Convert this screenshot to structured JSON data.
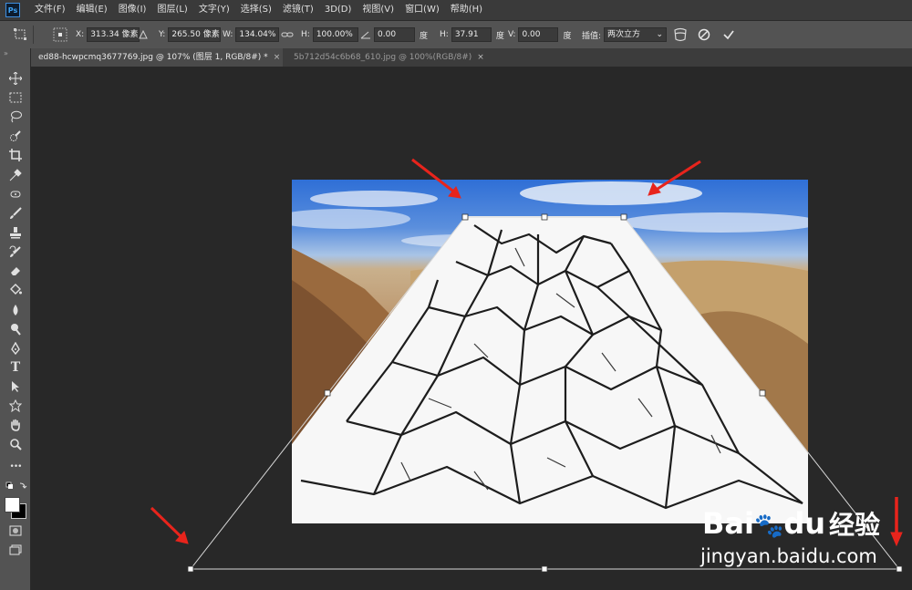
{
  "app": {
    "logo": "Ps"
  },
  "menu": [
    "文件(F)",
    "编辑(E)",
    "图像(I)",
    "图层(L)",
    "文字(Y)",
    "选择(S)",
    "滤镜(T)",
    "3D(D)",
    "视图(V)",
    "窗口(W)",
    "帮助(H)"
  ],
  "options": {
    "x_label": "X:",
    "x_value": "313.34 像素",
    "y_label": "Y:",
    "y_value": "265.50 像素",
    "w_label": "W:",
    "w_value": "134.04%",
    "h_label": "H:",
    "h_value": "100.00%",
    "angle_value": "0.00",
    "angle_unit": "度",
    "hskew_label": "H:",
    "hskew_value": "37.91",
    "hskew_unit": "度",
    "vskew_label": "V:",
    "vskew_value": "0.00",
    "vskew_unit": "度",
    "interp_label": "插值:",
    "interp_value": "两次立方"
  },
  "tabs": [
    {
      "label": "ed88-hcwpcmq3677769.jpg @ 107% (图层 1, RGB/8#) *",
      "close": "×"
    },
    {
      "label": "5b712d54c6b68_610.jpg @ 100%(RGB/8#)",
      "close": "×"
    }
  ],
  "tools": [
    "move-icon",
    "marquee-icon",
    "lasso-icon",
    "quick-select-icon",
    "crop-icon",
    "eyedropper-icon",
    "healing-icon",
    "brush-icon",
    "stamp-icon",
    "history-brush-icon",
    "eraser-icon",
    "paint-bucket-icon",
    "blur-icon",
    "dodge-icon",
    "pen-icon",
    "type-icon",
    "path-select-icon",
    "shape-icon",
    "hand-icon",
    "zoom-icon",
    "more-icon"
  ],
  "tool_glyphs": {
    "type": "T",
    "more": "•••"
  },
  "colors": {
    "accent_arrow": "#e8241c",
    "menubar": "#3a3a3a",
    "optionsbar": "#535353",
    "canvas": "#282828",
    "foreground": "#ffffff",
    "background": "#000000"
  },
  "watermark": {
    "brand": "Bai",
    "paw": "🐾",
    "brand2": "du",
    "cn": "经验",
    "url": "jingyan.baidu.com"
  }
}
